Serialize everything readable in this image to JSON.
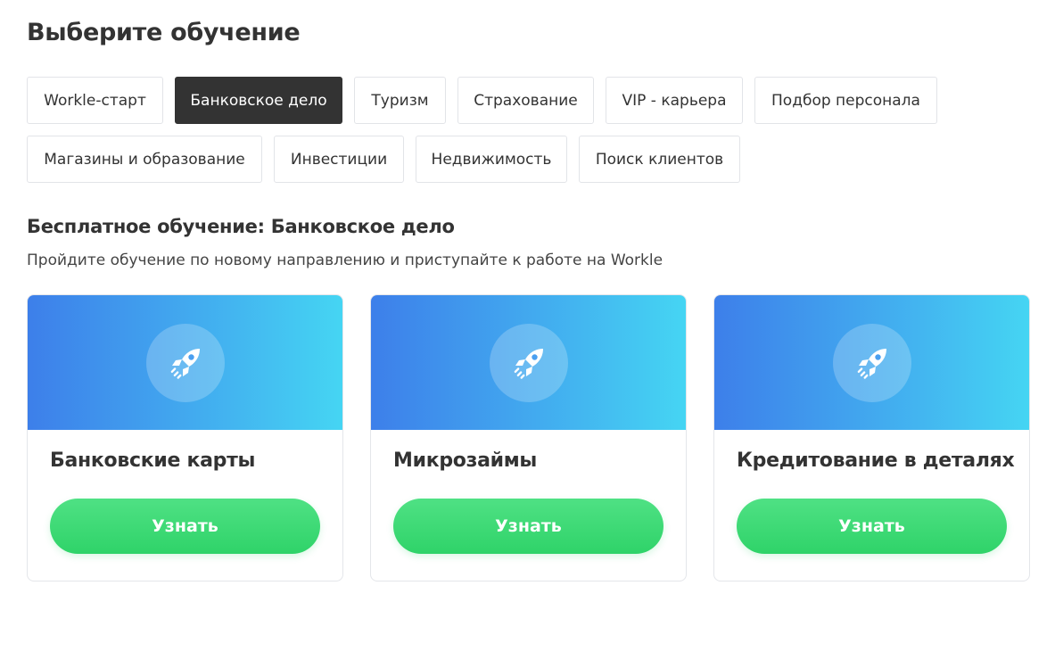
{
  "page": {
    "title": "Выберите обучение"
  },
  "tabs": [
    {
      "label": "Workle-старт",
      "active": false
    },
    {
      "label": "Банковское дело",
      "active": true
    },
    {
      "label": "Туризм",
      "active": false
    },
    {
      "label": "Страхование",
      "active": false
    },
    {
      "label": "VIP - карьера",
      "active": false
    },
    {
      "label": "Подбор персонала",
      "active": false
    },
    {
      "label": "Магазины и образование",
      "active": false
    },
    {
      "label": "Инвестиции",
      "active": false
    },
    {
      "label": "Недвижимость",
      "active": false
    },
    {
      "label": "Поиск клиентов",
      "active": false
    }
  ],
  "section": {
    "title": "Бесплатное обучение: Банковское дело",
    "subtitle": "Пройдите обучение по новому направлению и приступайте к работе на Workle"
  },
  "courses": [
    {
      "title": "Банковские карты",
      "button_label": "Узнать",
      "icon": "rocket-icon"
    },
    {
      "title": "Микрозаймы",
      "button_label": "Узнать",
      "icon": "rocket-icon"
    },
    {
      "title": "Кредитование в деталях",
      "button_label": "Узнать",
      "icon": "rocket-icon"
    }
  ],
  "colors": {
    "active_tab_bg": "#333333",
    "banner_gradient_start": "#3d7fea",
    "banner_gradient_end": "#45d5f3",
    "button_green": "#2fd369"
  }
}
